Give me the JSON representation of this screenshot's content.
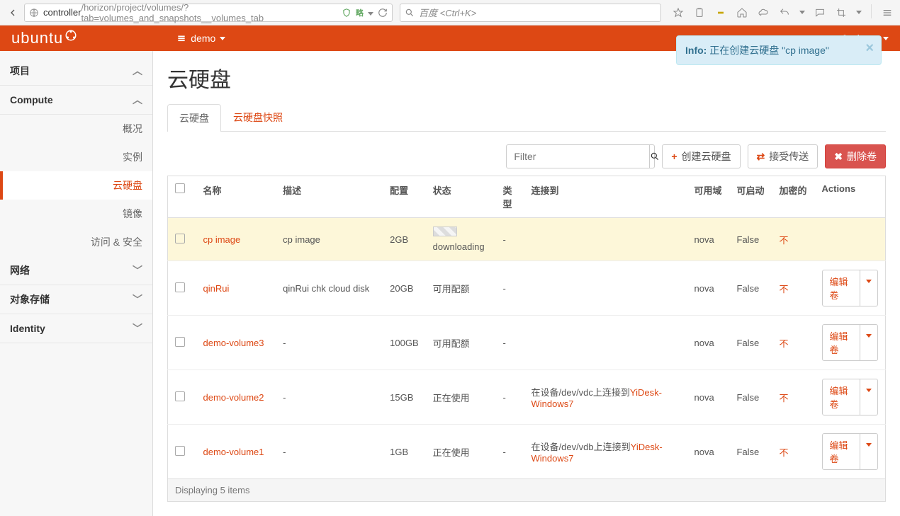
{
  "browser": {
    "url_domain": "controller",
    "url_path": "/horizon/project/volumes/?tab=volumes_and_snapshots__volumes_tab",
    "search_hint": "百度 <Ctrl+K>"
  },
  "topbar": {
    "logo": "ubuntu",
    "project": "demo",
    "user": "demo"
  },
  "alert": {
    "prefix": "Info:",
    "text": "正在创建云硬盘 \"cp image\""
  },
  "sidebar": {
    "project": "项目",
    "compute": "Compute",
    "overview": "概况",
    "instances": "实例",
    "volumes": "云硬盘",
    "images": "镜像",
    "access": "访问 & 安全",
    "network": "网络",
    "objstore": "对象存储",
    "identity": "Identity"
  },
  "page": {
    "title": "云硬盘",
    "tabs": {
      "volumes": "云硬盘",
      "snapshots": "云硬盘快照"
    },
    "filter_placeholder": "Filter",
    "create_label": "创建云硬盘",
    "accept_label": "接受传送",
    "delete_label": "删除卷",
    "display_footer": "Displaying 5 items"
  },
  "columns": {
    "name": "名称",
    "desc": "描述",
    "size": "配置",
    "status": "状态",
    "type": "类型",
    "attached": "连接到",
    "az": "可用域",
    "bootable": "可启动",
    "encrypted": "加密的",
    "actions": "Actions"
  },
  "rows": [
    {
      "name": "cp image",
      "desc": "cp image",
      "size": "2GB",
      "status": "downloading",
      "type": "-",
      "attached_prefix": "",
      "attached_link": "",
      "az": "nova",
      "bootable": "False",
      "encrypted": "不",
      "action_label": "",
      "highlight": true,
      "loading": true
    },
    {
      "name": "qinRui",
      "desc": "qinRui chk cloud disk",
      "size": "20GB",
      "status": "可用配额",
      "type": "-",
      "attached_prefix": "",
      "attached_link": "",
      "az": "nova",
      "bootable": "False",
      "encrypted": "不",
      "action_label": "编辑卷",
      "highlight": false,
      "loading": false
    },
    {
      "name": "demo-volume3",
      "desc": "-",
      "size": "100GB",
      "status": "可用配额",
      "type": "-",
      "attached_prefix": "",
      "attached_link": "",
      "az": "nova",
      "bootable": "False",
      "encrypted": "不",
      "action_label": "编辑卷",
      "highlight": false,
      "loading": false
    },
    {
      "name": "demo-volume2",
      "desc": "-",
      "size": "15GB",
      "status": "正在使用",
      "type": "-",
      "attached_prefix": "在设备/dev/vdc上连接到",
      "attached_link": "YiDesk-Windows7",
      "az": "nova",
      "bootable": "False",
      "encrypted": "不",
      "action_label": "编辑卷",
      "highlight": false,
      "loading": false
    },
    {
      "name": "demo-volume1",
      "desc": "-",
      "size": "1GB",
      "status": "正在使用",
      "type": "-",
      "attached_prefix": "在设备/dev/vdb上连接到",
      "attached_link": "YiDesk-Windows7",
      "az": "nova",
      "bootable": "False",
      "encrypted": "不",
      "action_label": "编辑卷",
      "highlight": false,
      "loading": false
    }
  ]
}
